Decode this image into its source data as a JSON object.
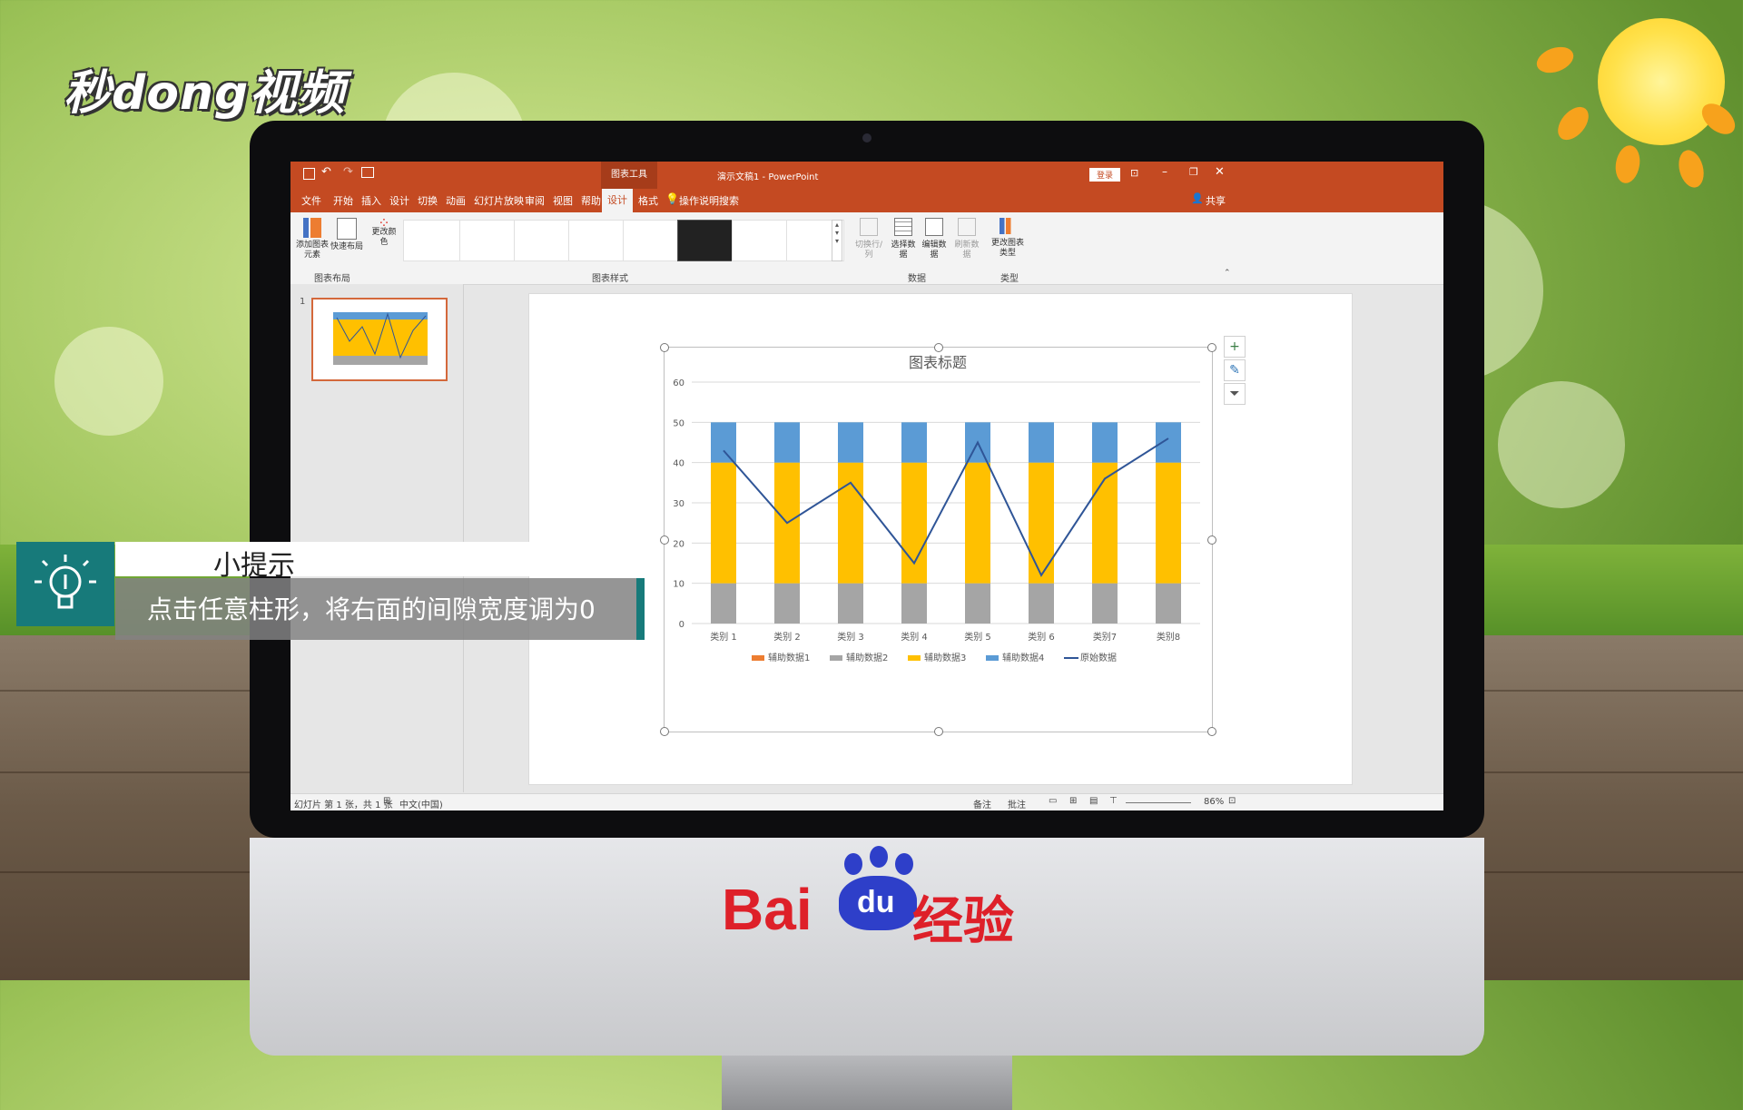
{
  "watermark": {
    "brand": "秒dong视频"
  },
  "window": {
    "title": "演示文稿1 - PowerPoint",
    "context_tab": "图表工具",
    "login_label": "登录",
    "share_label": "共享",
    "quick_access": [
      "save-icon",
      "undo-icon",
      "redo-icon",
      "present-icon"
    ]
  },
  "tabs": [
    "文件",
    "开始",
    "插入",
    "设计",
    "切换",
    "动画",
    "幻灯片放映",
    "审阅",
    "视图",
    "帮助",
    "设计",
    "格式"
  ],
  "active_tab": "设计",
  "search_label": "操作说明搜索",
  "ribbon": {
    "group_layout": "图表布局",
    "add_element": "添加图表元素",
    "quick_layout": "快速布局",
    "change_colors": "更改颜色",
    "group_styles": "图表样式",
    "switch_row_col": "切换行/列",
    "select_data": "选择数据",
    "edit_data": "编辑数据",
    "refresh_data": "刷新数据",
    "group_data": "数据",
    "change_type": "更改图表类型",
    "group_type": "类型"
  },
  "slide_number": "1",
  "status": {
    "slide_info": "幻灯片 第 1 张，共 1 张",
    "language": "中文(中国)",
    "notes": "备注",
    "comments": "批注",
    "zoom": "86%"
  },
  "chart_data": {
    "type": "bar",
    "stacked": true,
    "title": "图表标题",
    "categories": [
      "类别 1",
      "类别 2",
      "类别 3",
      "类别 4",
      "类别 5",
      "类别 6",
      "类别7",
      "类别8"
    ],
    "series": [
      {
        "name": "辅助数据1",
        "color": "#ed7d31",
        "values": [
          0,
          0,
          0,
          0,
          0,
          0,
          0,
          0
        ]
      },
      {
        "name": "辅助数据2",
        "color": "#a5a5a5",
        "values": [
          10,
          10,
          10,
          10,
          10,
          10,
          10,
          10
        ]
      },
      {
        "name": "辅助数据3",
        "color": "#ffc000",
        "values": [
          30,
          30,
          30,
          30,
          30,
          30,
          30,
          30
        ]
      },
      {
        "name": "辅助数据4",
        "color": "#5b9bd5",
        "values": [
          10,
          10,
          10,
          10,
          10,
          10,
          10,
          10
        ]
      }
    ],
    "line_series": {
      "name": "原始数据",
      "color": "#2f5597",
      "values": [
        43,
        25,
        35,
        15,
        45,
        12,
        36,
        46
      ]
    },
    "ylim": [
      0,
      60
    ],
    "yticks": [
      0,
      10,
      20,
      30,
      40,
      50,
      60
    ],
    "grid": true,
    "legend_position": "bottom"
  },
  "tip": {
    "title": "小提示",
    "text": "点击任意柱形，将右面的间隙宽度调为0"
  },
  "baidu": {
    "text": "Bai",
    "paw_text": "du",
    "suffix": "经验"
  }
}
